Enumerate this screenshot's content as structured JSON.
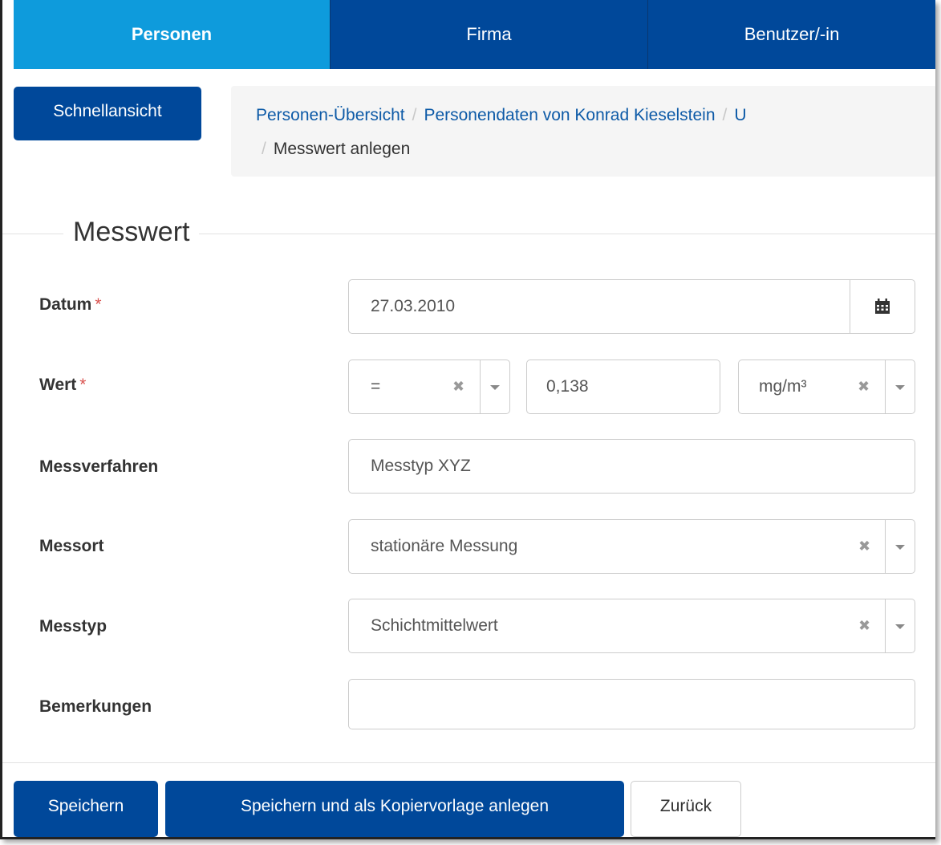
{
  "nav": {
    "tabs": [
      {
        "label": "Personen",
        "active": true
      },
      {
        "label": "Firma",
        "active": false
      },
      {
        "label": "Benutzer/-in",
        "active": false
      }
    ]
  },
  "quick_view_label": "Schnellansicht",
  "breadcrumb": {
    "items": [
      "Personen-Übersicht",
      "Personendaten von Konrad Kieselstein",
      "U"
    ],
    "current": "Messwert anlegen",
    "separator": "/"
  },
  "form": {
    "legend": "Messwert",
    "required_mark": "*",
    "datum": {
      "label": "Datum",
      "value": "27.03.2010",
      "icon": "calendar-icon"
    },
    "wert": {
      "label": "Wert",
      "operator": "=",
      "value": "0,138",
      "unit": "mg/m³"
    },
    "messverfahren": {
      "label": "Messverfahren",
      "value": "Messtyp XYZ"
    },
    "messort": {
      "label": "Messort",
      "value": "stationäre Messung"
    },
    "messtyp": {
      "label": "Messtyp",
      "value": "Schichtmittelwert"
    },
    "bemerkungen": {
      "label": "Bemerkungen",
      "value": ""
    },
    "clear_glyph": "✖"
  },
  "buttons": {
    "save": "Speichern",
    "save_copy": "Speichern und als Kopiervorlage anlegen",
    "back": "Zurück"
  },
  "colors": {
    "active_tab": "#0e9bdc",
    "primary": "#00489a",
    "link": "#0d5aa7",
    "required": "#d9534f"
  }
}
